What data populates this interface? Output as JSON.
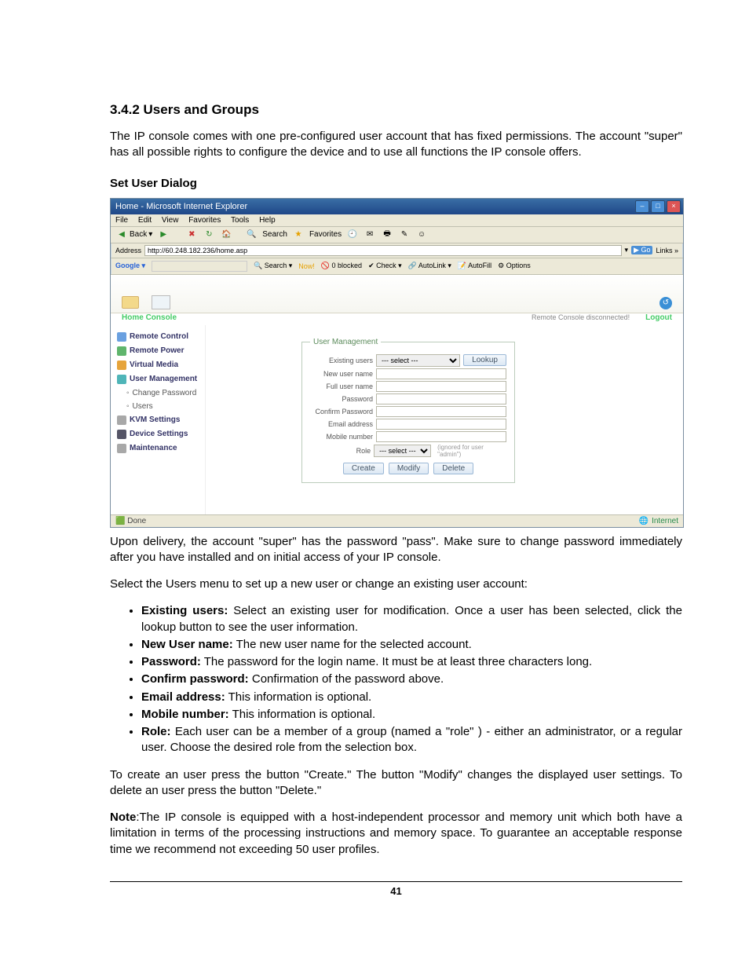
{
  "doc": {
    "heading": "3.4.2 Users and Groups",
    "intro": "The IP console comes with one pre-configured user account that has fixed permissions. The account \"super\" has all possible rights to configure the device and to use all functions the IP console offers.",
    "sub_heading": "Set User Dialog",
    "after_shot_1": "Upon delivery, the account \"super\" has the password \"pass\". Make sure to change password immediately after you have installed and on initial access of your IP console.",
    "after_shot_2": "Select the Users menu to set up a new user or change an existing user account:",
    "bullets": [
      {
        "term": "Existing users:",
        "desc": " Select an existing user for modification. Once a user has been selected, click the lookup button to see the user information."
      },
      {
        "term": "New User name:",
        "desc": " The new user name for the selected account."
      },
      {
        "term": "Password:",
        "desc": " The password for the login name. It must be at least three characters long."
      },
      {
        "term": "Confirm password:",
        "desc": " Confirmation of the password above."
      },
      {
        "term": "Email address:",
        "desc": " This information is optional."
      },
      {
        "term": "Mobile number:",
        "desc": " This information is optional."
      },
      {
        "term": "Role:",
        "desc": " Each user can be a member of a group (named a \"role\" ) - either an administrator, or a regular user. Choose the desired role from the selection box."
      }
    ],
    "create_modify": "To create an user press the button \"Create.\" The button \"Modify\" changes the displayed user settings. To delete an user press the button \"Delete.\"",
    "note": "Note:The IP console is equipped with a host-independent processor and memory unit which both have a limitation in terms of the processing instructions and memory space. To guarantee an acceptable response time we recommend not exceeding 50 user profiles.",
    "page_number": "41"
  },
  "ie": {
    "title": "Home - Microsoft Internet Explorer",
    "menus": [
      "File",
      "Edit",
      "View",
      "Favorites",
      "Tools",
      "Help"
    ],
    "back": "Back",
    "search": "Search",
    "favorites": "Favorites",
    "address_label": "Address",
    "url": "http://60.248.182.236/home.asp",
    "go": "Go",
    "links": "Links »",
    "google": {
      "brand": "Google ▾",
      "items": [
        "Search ▾",
        "Now!",
        "0 blocked",
        "Check ▾",
        "AutoLink ▾",
        "AutoFill",
        "Options"
      ]
    },
    "status_done": "Done",
    "status_zone": "Internet"
  },
  "app": {
    "tabs": [
      "Home",
      "Console"
    ],
    "status": "Remote Console disconnected!",
    "logout": "Logout",
    "nav": [
      {
        "label": "Remote Control"
      },
      {
        "label": "Remote Power"
      },
      {
        "label": "Virtual Media"
      },
      {
        "label": "User Management"
      },
      {
        "label": "Change Password",
        "sub": true
      },
      {
        "label": "Users",
        "sub": true
      },
      {
        "label": "KVM Settings"
      },
      {
        "label": "Device Settings"
      },
      {
        "label": "Maintenance"
      }
    ],
    "form": {
      "legend": "User Management",
      "existing_users": "Existing users",
      "select_placeholder": "--- select ---",
      "lookup": "Lookup",
      "new_user_name": "New user name",
      "full_user_name": "Full user name",
      "password": "Password",
      "confirm_password": "Confirm Password",
      "email_address": "Email address",
      "mobile_number": "Mobile number",
      "role": "Role",
      "role_note": "(ignored for user \"admin\")",
      "create": "Create",
      "modify": "Modify",
      "delete": "Delete"
    }
  }
}
